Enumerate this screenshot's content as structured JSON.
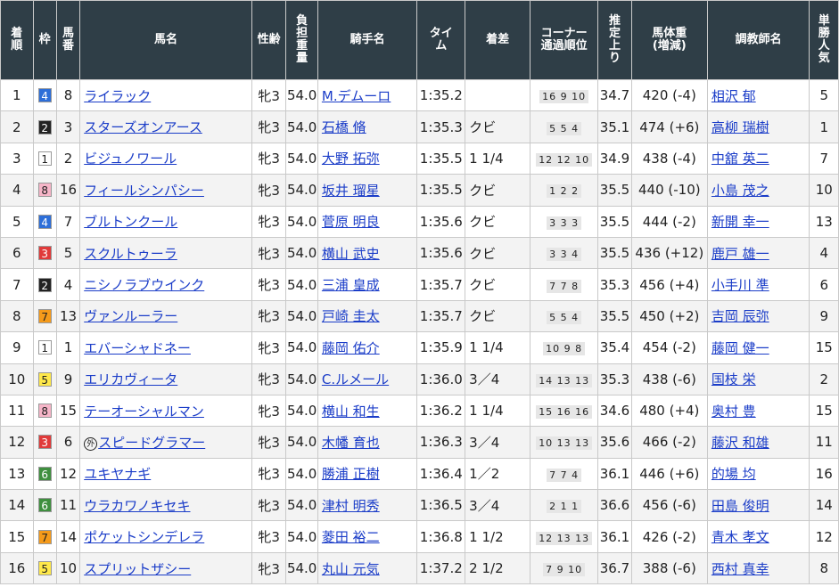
{
  "headers": {
    "rank": "着\n順",
    "waku": "枠",
    "umaban": "馬\n番",
    "horse": "馬名",
    "sexage": "性齢",
    "weight": "負\n担\n重\n量",
    "jockey": "騎手名",
    "time": "タイ\nム",
    "margin": "着差",
    "corner": "コーナー\n通過順位",
    "last": "推\n定\n上\nり",
    "body": "馬体重\n(増減)",
    "trainer": "調教師名",
    "pop": "単\n勝\n人\n気"
  },
  "waku_colors": {
    "1": {
      "bg": "#ffffff",
      "fg": "#222222"
    },
    "2": {
      "bg": "#222222",
      "fg": "#ffffff"
    },
    "3": {
      "bg": "#e03a3a",
      "fg": "#ffffff"
    },
    "4": {
      "bg": "#2d6ed8",
      "fg": "#ffffff"
    },
    "5": {
      "bg": "#ffe94a",
      "fg": "#222222"
    },
    "6": {
      "bg": "#3f8f3f",
      "fg": "#ffffff"
    },
    "7": {
      "bg": "#f59a1a",
      "fg": "#222222"
    },
    "8": {
      "bg": "#f6b5c8",
      "fg": "#222222"
    }
  },
  "rows": [
    {
      "rank": "1",
      "waku": "4",
      "umaban": "8",
      "horse": "ライラック",
      "gai": "",
      "sexage": "牝3",
      "weight": "54.0",
      "jockey": "M.デムーロ",
      "time": "1:35.2",
      "margin": "",
      "corner": "16 9 10",
      "last": "34.7",
      "body": "420 (-4)",
      "trainer": "相沢 郁",
      "pop": "5"
    },
    {
      "rank": "2",
      "waku": "2",
      "umaban": "3",
      "horse": "スターズオンアース",
      "gai": "",
      "sexage": "牝3",
      "weight": "54.0",
      "jockey": "石橋 脩",
      "time": "1:35.3",
      "margin": "クビ",
      "corner": "5 5 4",
      "last": "35.1",
      "body": "474 (+6)",
      "trainer": "高柳 瑞樹",
      "pop": "1"
    },
    {
      "rank": "3",
      "waku": "1",
      "umaban": "2",
      "horse": "ビジュノワール",
      "gai": "",
      "sexage": "牝3",
      "weight": "54.0",
      "jockey": "大野 拓弥",
      "time": "1:35.5",
      "margin": "1 1/4",
      "corner": "12 12 10",
      "last": "34.9",
      "body": "438 (-4)",
      "trainer": "中舘 英二",
      "pop": "7"
    },
    {
      "rank": "4",
      "waku": "8",
      "umaban": "16",
      "horse": "フィールシンパシー",
      "gai": "",
      "sexage": "牝3",
      "weight": "54.0",
      "jockey": "坂井 瑠星",
      "time": "1:35.5",
      "margin": "クビ",
      "corner": "1 2 2",
      "last": "35.5",
      "body": "440 (-10)",
      "trainer": "小島 茂之",
      "pop": "10"
    },
    {
      "rank": "5",
      "waku": "4",
      "umaban": "7",
      "horse": "ブルトンクール",
      "gai": "",
      "sexage": "牝3",
      "weight": "54.0",
      "jockey": "菅原 明良",
      "time": "1:35.6",
      "margin": "クビ",
      "corner": "3 3 3",
      "last": "35.5",
      "body": "444 (-2)",
      "trainer": "新開 幸一",
      "pop": "13"
    },
    {
      "rank": "6",
      "waku": "3",
      "umaban": "5",
      "horse": "スクルトゥーラ",
      "gai": "",
      "sexage": "牝3",
      "weight": "54.0",
      "jockey": "横山 武史",
      "time": "1:35.6",
      "margin": "クビ",
      "corner": "3 3 4",
      "last": "35.5",
      "body": "436 (+12)",
      "trainer": "鹿戸 雄一",
      "pop": "4"
    },
    {
      "rank": "7",
      "waku": "2",
      "umaban": "4",
      "horse": "ニシノラブウインク",
      "gai": "",
      "sexage": "牝3",
      "weight": "54.0",
      "jockey": "三浦 皇成",
      "time": "1:35.7",
      "margin": "クビ",
      "corner": "7 7 8",
      "last": "35.3",
      "body": "456 (+4)",
      "trainer": "小手川 準",
      "pop": "6"
    },
    {
      "rank": "8",
      "waku": "7",
      "umaban": "13",
      "horse": "ヴァンルーラー",
      "gai": "",
      "sexage": "牝3",
      "weight": "54.0",
      "jockey": "戸崎 圭太",
      "time": "1:35.7",
      "margin": "クビ",
      "corner": "5 5 4",
      "last": "35.5",
      "body": "450 (+2)",
      "trainer": "吉岡 辰弥",
      "pop": "9"
    },
    {
      "rank": "9",
      "waku": "1",
      "umaban": "1",
      "horse": "エバーシャドネー",
      "gai": "",
      "sexage": "牝3",
      "weight": "54.0",
      "jockey": "藤岡 佑介",
      "time": "1:35.9",
      "margin": "1 1/4",
      "corner": "10 9 8",
      "last": "35.4",
      "body": "454 (-2)",
      "trainer": "藤岡 健一",
      "pop": "15"
    },
    {
      "rank": "10",
      "waku": "5",
      "umaban": "9",
      "horse": "エリカヴィータ",
      "gai": "",
      "sexage": "牝3",
      "weight": "54.0",
      "jockey": "C.ルメール",
      "time": "1:36.0",
      "margin": "3／4",
      "corner": "14 13 13",
      "last": "35.3",
      "body": "438 (-6)",
      "trainer": "国枝 栄",
      "pop": "2"
    },
    {
      "rank": "11",
      "waku": "8",
      "umaban": "15",
      "horse": "テーオーシャルマン",
      "gai": "",
      "sexage": "牝3",
      "weight": "54.0",
      "jockey": "横山 和生",
      "time": "1:36.2",
      "margin": "1 1/4",
      "corner": "15 16 16",
      "last": "34.6",
      "body": "480 (+4)",
      "trainer": "奥村 豊",
      "pop": "15"
    },
    {
      "rank": "12",
      "waku": "3",
      "umaban": "6",
      "horse": "スピードグラマー",
      "gai": "外",
      "sexage": "牝3",
      "weight": "54.0",
      "jockey": "木幡 育也",
      "time": "1:36.3",
      "margin": "3／4",
      "corner": "10 13 13",
      "last": "35.6",
      "body": "466 (-2)",
      "trainer": "藤沢 和雄",
      "pop": "11"
    },
    {
      "rank": "13",
      "waku": "6",
      "umaban": "12",
      "horse": "ユキヤナギ",
      "gai": "",
      "sexage": "牝3",
      "weight": "54.0",
      "jockey": "勝浦 正樹",
      "time": "1:36.4",
      "margin": "1／2",
      "corner": "7 7 4",
      "last": "36.1",
      "body": "446 (+6)",
      "trainer": "的場 均",
      "pop": "16"
    },
    {
      "rank": "14",
      "waku": "6",
      "umaban": "11",
      "horse": "ウラカワノキセキ",
      "gai": "",
      "sexage": "牝3",
      "weight": "54.0",
      "jockey": "津村 明秀",
      "time": "1:36.5",
      "margin": "3／4",
      "corner": "2 1 1",
      "last": "36.6",
      "body": "456 (-6)",
      "trainer": "田島 俊明",
      "pop": "14"
    },
    {
      "rank": "15",
      "waku": "7",
      "umaban": "14",
      "horse": "ポケットシンデレラ",
      "gai": "",
      "sexage": "牝3",
      "weight": "54.0",
      "jockey": "菱田 裕二",
      "time": "1:36.8",
      "margin": "1 1/2",
      "corner": "12 13 13",
      "last": "36.1",
      "body": "426 (-2)",
      "trainer": "青木 孝文",
      "pop": "12"
    },
    {
      "rank": "16",
      "waku": "5",
      "umaban": "10",
      "horse": "スプリットザシー",
      "gai": "",
      "sexage": "牝3",
      "weight": "54.0",
      "jockey": "丸山 元気",
      "time": "1:37.2",
      "margin": "2 1/2",
      "corner": "7 9 10",
      "last": "36.7",
      "body": "388 (-6)",
      "trainer": "西村 真幸",
      "pop": "8"
    }
  ]
}
